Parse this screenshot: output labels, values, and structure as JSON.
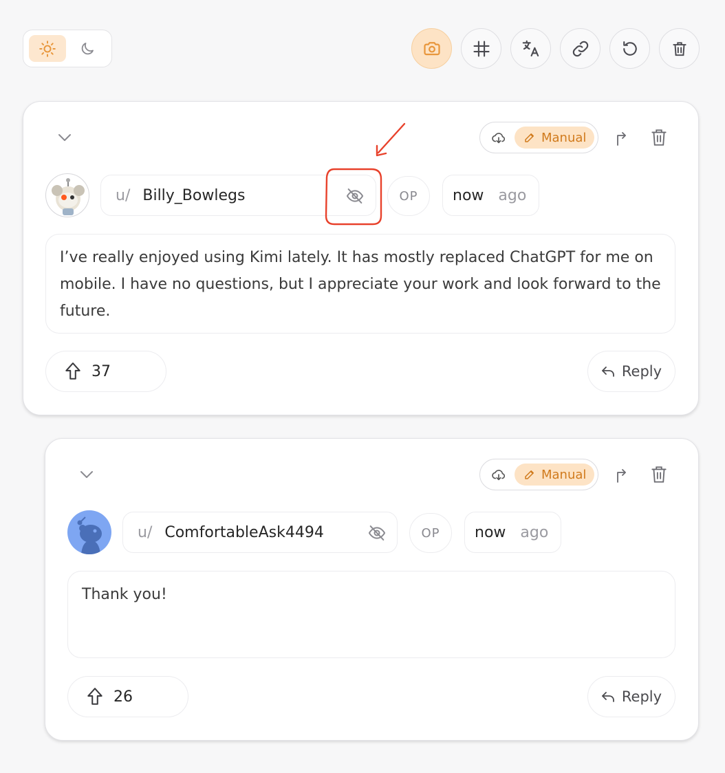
{
  "toolbar": {
    "theme": {
      "light_icon": "sun-icon",
      "dark_icon": "moon-icon",
      "active": "light"
    },
    "actions": [
      {
        "icon": "camera-icon",
        "active": true
      },
      {
        "icon": "hashtag-icon",
        "active": false
      },
      {
        "icon": "translate-icon",
        "active": false
      },
      {
        "icon": "link-icon",
        "active": false
      },
      {
        "icon": "reset-icon",
        "active": false
      },
      {
        "icon": "trash-icon",
        "active": false
      }
    ],
    "accent_color": "#f09a3e"
  },
  "comments": [
    {
      "mode_label": "Manual",
      "user_prefix": "u/",
      "username": "Billy_Bowlegs",
      "op_label": "OP",
      "time": "now",
      "ago": "ago",
      "body": "I’ve really enjoyed using Kimi lately. It has mostly replaced ChatGPT for me on mobile. I have no questions, but I appreciate your work and look forward to the future.",
      "votes": "37",
      "reply_label": "Reply"
    },
    {
      "mode_label": "Manual",
      "user_prefix": "u/",
      "username": "ComfortableAsk4494",
      "op_label": "OP",
      "time": "now",
      "ago": "ago",
      "body": "Thank you!",
      "votes": "26",
      "reply_label": "Reply"
    }
  ],
  "annotation": {
    "color": "#e8412b"
  }
}
